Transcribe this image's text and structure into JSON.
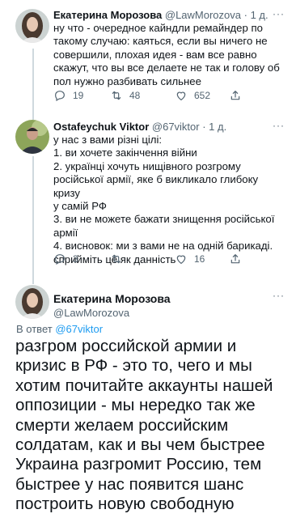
{
  "tweets": [
    {
      "name": "Екатерина Морозова",
      "handle": "@LawMorozova",
      "time": "· 1 д.",
      "text": "ну что - очередное кайндли ремайндер по\nтакому случаю: каяться, если вы ничего не\nсовершили, плохая идея - вам все равно\nскажут, что вы все делаете не так и голову об\nпол нужно разбивать сильнее",
      "replies": "19",
      "retweets": "48",
      "likes": "652"
    },
    {
      "name": "Ostafeychuk Viktor",
      "handle": "@67viktor",
      "time": "· 1 д.",
      "text": "у нас з вами різні цілі:\n1. ви хочете закінчення війни\n2. українці хочуть нищівного розгрому\nросійської армії, яке б викликало глибоку кризу\nу самій РФ\n3. ви не можете бажати знищення російської\nармії\n4. висновок: ми з вами не на одній барикаді.\nсприйміть це як данність",
      "replies": "3",
      "retweets": "",
      "likes": "16"
    }
  ],
  "main_tweet": {
    "name": "Екатерина Морозова",
    "handle": "@LawMorozova",
    "reply_prefix": "В ответ",
    "reply_to": "@67viktor",
    "text": "разгром российской армии и кризис в РФ - это то, чего и мы хотим почитайте аккаунты нашей оппозиции - мы нередко так же смерти желаем российским солдатам, как и вы чем быстрее Украина разгромит Россию, тем быстрее у нас появится шанс построить новую свободную страну"
  },
  "more_icon_text": "···",
  "colors": {
    "accent": "#1d9bf0",
    "muted": "#536471",
    "line": "#cfd9de"
  }
}
